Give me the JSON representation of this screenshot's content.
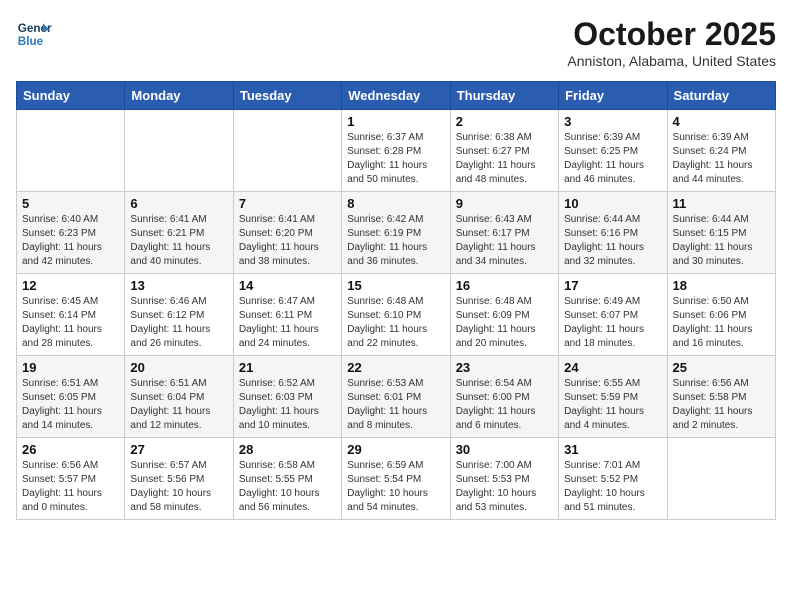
{
  "logo": {
    "line1": "General",
    "line2": "Blue"
  },
  "title": "October 2025",
  "location": "Anniston, Alabama, United States",
  "weekdays": [
    "Sunday",
    "Monday",
    "Tuesday",
    "Wednesday",
    "Thursday",
    "Friday",
    "Saturday"
  ],
  "weeks": [
    [
      {
        "day": "",
        "info": ""
      },
      {
        "day": "",
        "info": ""
      },
      {
        "day": "",
        "info": ""
      },
      {
        "day": "1",
        "info": "Sunrise: 6:37 AM\nSunset: 6:28 PM\nDaylight: 11 hours\nand 50 minutes."
      },
      {
        "day": "2",
        "info": "Sunrise: 6:38 AM\nSunset: 6:27 PM\nDaylight: 11 hours\nand 48 minutes."
      },
      {
        "day": "3",
        "info": "Sunrise: 6:39 AM\nSunset: 6:25 PM\nDaylight: 11 hours\nand 46 minutes."
      },
      {
        "day": "4",
        "info": "Sunrise: 6:39 AM\nSunset: 6:24 PM\nDaylight: 11 hours\nand 44 minutes."
      }
    ],
    [
      {
        "day": "5",
        "info": "Sunrise: 6:40 AM\nSunset: 6:23 PM\nDaylight: 11 hours\nand 42 minutes."
      },
      {
        "day": "6",
        "info": "Sunrise: 6:41 AM\nSunset: 6:21 PM\nDaylight: 11 hours\nand 40 minutes."
      },
      {
        "day": "7",
        "info": "Sunrise: 6:41 AM\nSunset: 6:20 PM\nDaylight: 11 hours\nand 38 minutes."
      },
      {
        "day": "8",
        "info": "Sunrise: 6:42 AM\nSunset: 6:19 PM\nDaylight: 11 hours\nand 36 minutes."
      },
      {
        "day": "9",
        "info": "Sunrise: 6:43 AM\nSunset: 6:17 PM\nDaylight: 11 hours\nand 34 minutes."
      },
      {
        "day": "10",
        "info": "Sunrise: 6:44 AM\nSunset: 6:16 PM\nDaylight: 11 hours\nand 32 minutes."
      },
      {
        "day": "11",
        "info": "Sunrise: 6:44 AM\nSunset: 6:15 PM\nDaylight: 11 hours\nand 30 minutes."
      }
    ],
    [
      {
        "day": "12",
        "info": "Sunrise: 6:45 AM\nSunset: 6:14 PM\nDaylight: 11 hours\nand 28 minutes."
      },
      {
        "day": "13",
        "info": "Sunrise: 6:46 AM\nSunset: 6:12 PM\nDaylight: 11 hours\nand 26 minutes."
      },
      {
        "day": "14",
        "info": "Sunrise: 6:47 AM\nSunset: 6:11 PM\nDaylight: 11 hours\nand 24 minutes."
      },
      {
        "day": "15",
        "info": "Sunrise: 6:48 AM\nSunset: 6:10 PM\nDaylight: 11 hours\nand 22 minutes."
      },
      {
        "day": "16",
        "info": "Sunrise: 6:48 AM\nSunset: 6:09 PM\nDaylight: 11 hours\nand 20 minutes."
      },
      {
        "day": "17",
        "info": "Sunrise: 6:49 AM\nSunset: 6:07 PM\nDaylight: 11 hours\nand 18 minutes."
      },
      {
        "day": "18",
        "info": "Sunrise: 6:50 AM\nSunset: 6:06 PM\nDaylight: 11 hours\nand 16 minutes."
      }
    ],
    [
      {
        "day": "19",
        "info": "Sunrise: 6:51 AM\nSunset: 6:05 PM\nDaylight: 11 hours\nand 14 minutes."
      },
      {
        "day": "20",
        "info": "Sunrise: 6:51 AM\nSunset: 6:04 PM\nDaylight: 11 hours\nand 12 minutes."
      },
      {
        "day": "21",
        "info": "Sunrise: 6:52 AM\nSunset: 6:03 PM\nDaylight: 11 hours\nand 10 minutes."
      },
      {
        "day": "22",
        "info": "Sunrise: 6:53 AM\nSunset: 6:01 PM\nDaylight: 11 hours\nand 8 minutes."
      },
      {
        "day": "23",
        "info": "Sunrise: 6:54 AM\nSunset: 6:00 PM\nDaylight: 11 hours\nand 6 minutes."
      },
      {
        "day": "24",
        "info": "Sunrise: 6:55 AM\nSunset: 5:59 PM\nDaylight: 11 hours\nand 4 minutes."
      },
      {
        "day": "25",
        "info": "Sunrise: 6:56 AM\nSunset: 5:58 PM\nDaylight: 11 hours\nand 2 minutes."
      }
    ],
    [
      {
        "day": "26",
        "info": "Sunrise: 6:56 AM\nSunset: 5:57 PM\nDaylight: 11 hours\nand 0 minutes."
      },
      {
        "day": "27",
        "info": "Sunrise: 6:57 AM\nSunset: 5:56 PM\nDaylight: 10 hours\nand 58 minutes."
      },
      {
        "day": "28",
        "info": "Sunrise: 6:58 AM\nSunset: 5:55 PM\nDaylight: 10 hours\nand 56 minutes."
      },
      {
        "day": "29",
        "info": "Sunrise: 6:59 AM\nSunset: 5:54 PM\nDaylight: 10 hours\nand 54 minutes."
      },
      {
        "day": "30",
        "info": "Sunrise: 7:00 AM\nSunset: 5:53 PM\nDaylight: 10 hours\nand 53 minutes."
      },
      {
        "day": "31",
        "info": "Sunrise: 7:01 AM\nSunset: 5:52 PM\nDaylight: 10 hours\nand 51 minutes."
      },
      {
        "day": "",
        "info": ""
      }
    ]
  ]
}
